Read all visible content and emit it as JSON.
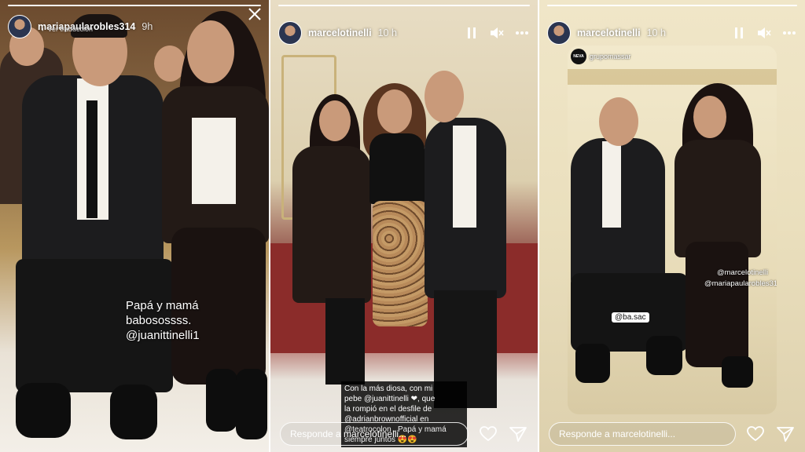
{
  "story1": {
    "username": "mariapaularobles314",
    "time": "9h",
    "translation_label": "Ver traducción",
    "caption_lines": [
      "Papá y mamá",
      "babosossss.",
      "@juanittinelli1"
    ],
    "progress_segments": 1,
    "progress_done": 1
  },
  "story2": {
    "username": "marcelotinelli",
    "time": "10 h",
    "caption_lines": [
      "Con la más diosa, con mi",
      "pebe @juanittinelli ❤, que",
      "la rompió en el desfile de",
      "@adrianbrownofficial en",
      "@teatrocolon . Papá y mamá",
      "siempre juntos 😍😍"
    ],
    "reply_placeholder": "Responde a marcelotinelli...",
    "progress_segments": 1,
    "progress_done": 1
  },
  "story3": {
    "username": "marcelotinelli",
    "time": "10 h",
    "repost_account": "grupomassar",
    "repost_avatar_text": "NEVA",
    "mention_tag": "@ba.sac",
    "tags": [
      "@marcelotinelli",
      "@mariapaularobles314"
    ],
    "reply_placeholder": "Responde a marcelotinelli...",
    "progress_segments": 1,
    "progress_done": 1
  },
  "icons": {
    "pause": "pause-icon",
    "mute": "mute-icon",
    "more": "more-icon",
    "close": "close-icon",
    "like": "heart-icon",
    "share": "send-icon"
  },
  "colors": {
    "white": "#ffffff",
    "caption_bg": "#000000"
  }
}
